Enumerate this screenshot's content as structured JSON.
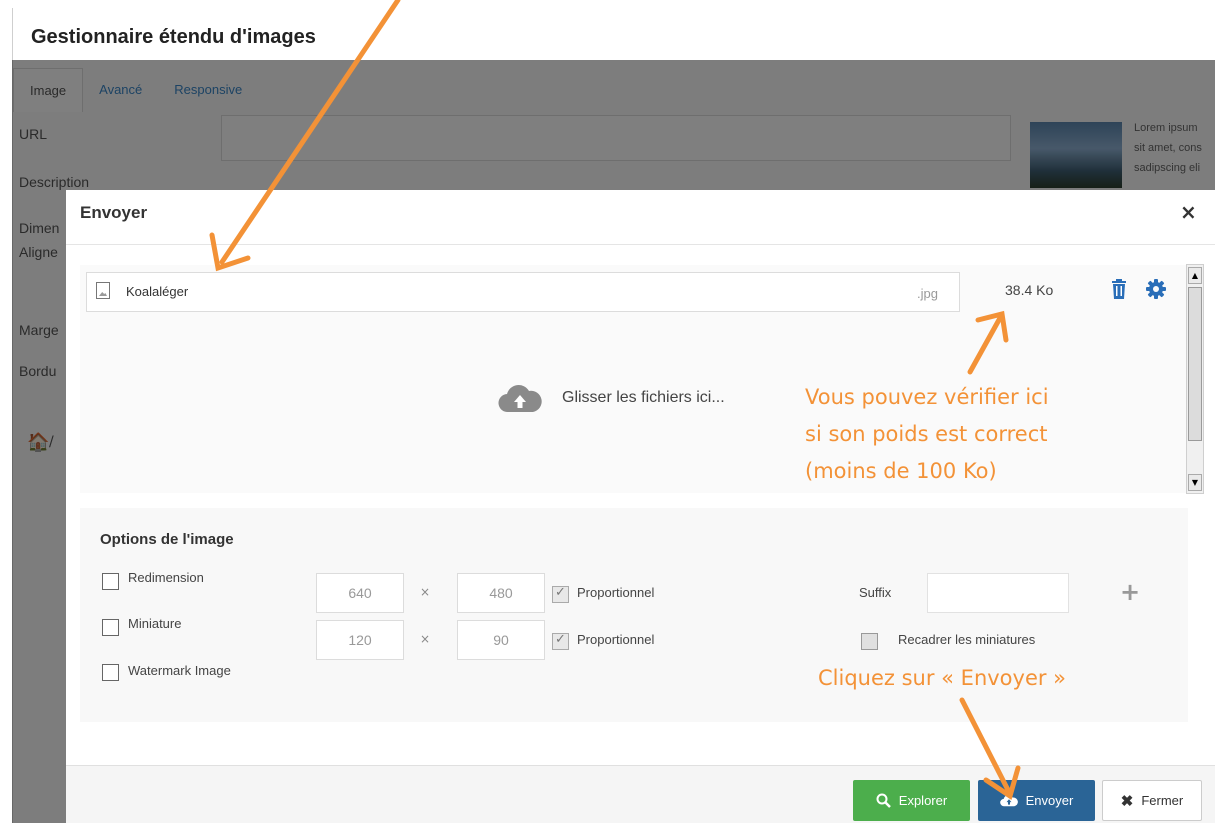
{
  "window": {
    "title": "Gestionnaire étendu d'images",
    "tabs": [
      "Image",
      "Avancé",
      "Responsive"
    ],
    "fields": [
      "URL",
      "Description",
      "Dimen",
      "Aligne",
      "Marge",
      "Bordu"
    ],
    "lorem_lines": [
      "Lorem ipsum",
      "sit amet, cons",
      "sadipscing eli"
    ],
    "breadcrumb_sep": "/"
  },
  "modal": {
    "title": "Envoyer",
    "close": "×",
    "file": {
      "name": "Koalaléger",
      "ext": ".jpg",
      "size": "38.4 Ko"
    },
    "dropzone_text": "Glisser les fichiers ici...",
    "options": {
      "title": "Options de l'image",
      "resize": {
        "label": "Redimension",
        "width": "640",
        "height": "480",
        "proportional": "Proportionnel",
        "checked": false
      },
      "thumbnail": {
        "label": "Miniature",
        "width": "120",
        "height": "90",
        "proportional": "Proportionnel",
        "checked": false
      },
      "watermark": {
        "label": "Watermark Image",
        "checked": false
      },
      "times": "×",
      "suffix_label": "Suffix",
      "suffix_value": "",
      "crop_label": "Recadrer les miniatures",
      "add": "+"
    },
    "buttons": {
      "explorer": "Explorer",
      "upload": "Envoyer",
      "close": "Fermer"
    }
  },
  "annotations": {
    "weight_note": [
      "Vous pouvez vérifier ici",
      "si son poids est correct",
      "(moins de 100 Ko)"
    ],
    "click_note": "Cliquez sur « Envoyer »",
    "color": "#f39237"
  },
  "colors": {
    "explorer_btn": "#4cae4c",
    "upload_btn": "#2a6496",
    "link": "#3a87c8"
  }
}
